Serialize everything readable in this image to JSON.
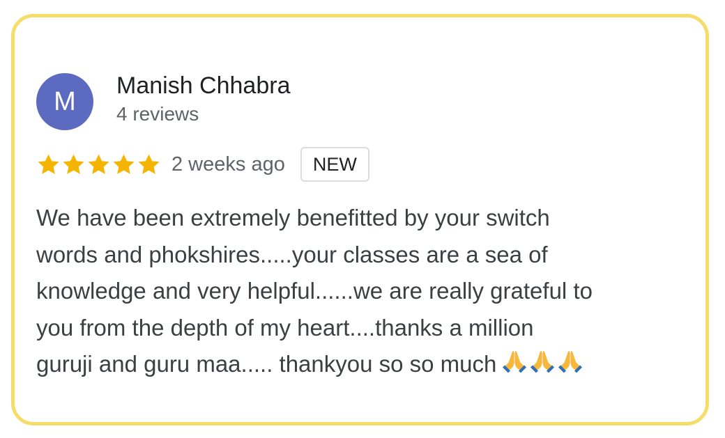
{
  "review": {
    "reviewer": {
      "initial": "M",
      "name": "Manish Chhabra",
      "review_count": "4 reviews",
      "avatar_color": "#5c6bc0"
    },
    "rating": 5,
    "max_rating": 5,
    "time_ago": "2 weeks ago",
    "badge": "NEW",
    "text": "We have been extremely benefitted by your switch\nwords and phokshires.....your classes are a sea of\nknowledge and very helpful......we are really grateful to\nyou from the depth of my heart....thanks a million\nguruji and guru maa..... thankyou so so much",
    "emoji": [
      "folded-hands",
      "folded-hands",
      "folded-hands"
    ]
  },
  "colors": {
    "card_border": "#f6dd6a",
    "star": "#f4b400",
    "name_text": "#202124",
    "secondary_text": "#5f6368",
    "body_text": "#3c4043"
  }
}
